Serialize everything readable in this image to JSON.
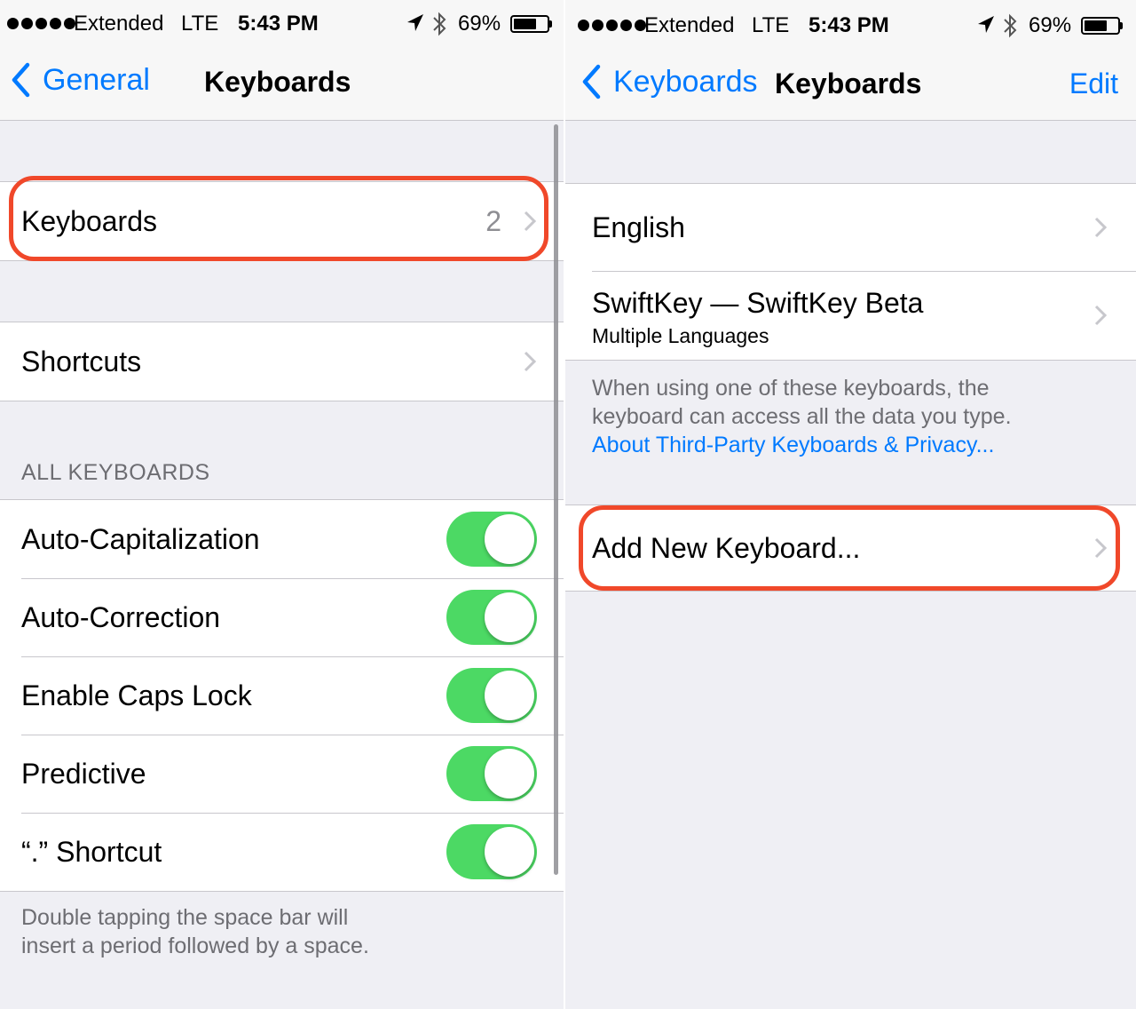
{
  "left": {
    "status": {
      "carrier": "Extended",
      "network": "LTE",
      "time": "5:43 PM",
      "battery": "69%",
      "battery_level": 0.69
    },
    "nav": {
      "back_label": "General",
      "title": "Keyboards"
    },
    "keyboards_row": {
      "label": "Keyboards",
      "value": "2"
    },
    "shortcuts_row": {
      "label": "Shortcuts"
    },
    "all_keyboards_header": "ALL KEYBOARDS",
    "toggles": [
      {
        "label": "Auto-Capitalization",
        "on": true
      },
      {
        "label": "Auto-Correction",
        "on": true
      },
      {
        "label": "Enable Caps Lock",
        "on": true
      },
      {
        "label": "Predictive",
        "on": true
      },
      {
        "label": "“.” Shortcut",
        "on": true
      }
    ],
    "footer_line1": "Double tapping the space bar will",
    "footer_line2": "insert a period followed by a space."
  },
  "right": {
    "status": {
      "carrier": "Extended",
      "network": "LTE",
      "time": "5:43 PM",
      "battery": "69%",
      "battery_level": 0.69
    },
    "nav": {
      "back_label": "Keyboards",
      "title": "Keyboards",
      "right_button": "Edit"
    },
    "keyboard_list": [
      {
        "label": "English"
      },
      {
        "label": "SwiftKey — SwiftKey Beta",
        "sublabel": "Multiple Languages"
      }
    ],
    "footer_line1": "When using one of these keyboards, the",
    "footer_line2": "keyboard can access all the data you type.",
    "footer_link": "About Third-Party Keyboards & Privacy...",
    "add_keyboard_label": "Add New Keyboard..."
  },
  "colors": {
    "accent": "#007aff",
    "toggle_on": "#4cd964",
    "highlight": "#f0482a",
    "background": "#efeff4"
  },
  "icons": [
    "location-arrow-icon",
    "bluetooth-icon",
    "battery-icon",
    "back-chevron-icon",
    "disclosure-chevron-icon"
  ]
}
